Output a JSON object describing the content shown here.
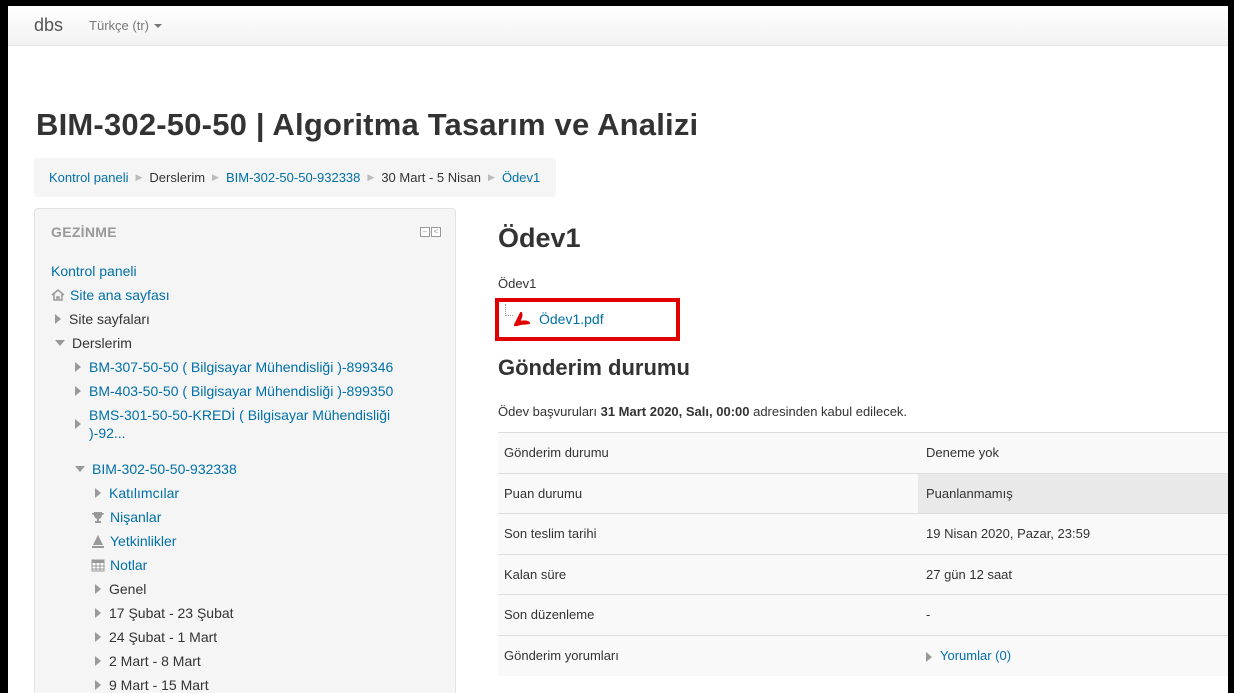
{
  "navbar": {
    "brand": "dbs",
    "language": "Türkçe (tr)"
  },
  "course_title": "BIM-302-50-50 | Algoritma Tasarım ve Analizi",
  "breadcrumb": [
    "Kontrol paneli",
    "Derslerim",
    "BIM-302-50-50-932338",
    "30 Mart - 5 Nisan",
    "Ödev1"
  ],
  "navigation": {
    "title": "GEZİNME",
    "dashboard": "Kontrol paneli",
    "site_home": "Site ana sayfası",
    "site_pages": "Site sayfaları",
    "my_courses": "Derslerim",
    "courses": [
      "BM-307-50-50 ( Bilgisayar Mühendisliği )-899346",
      "BM-403-50-50 ( Bilgisayar Mühendisliği )-899350",
      "BMS-301-50-50-KREDİ ( Bilgisayar Mühendisliği",
      ")-92..."
    ],
    "current_course": "BIM-302-50-50-932338",
    "current_course_items": [
      "Katılımcılar",
      "Nişanlar",
      "Yetkinlikler",
      "Notlar",
      "Genel",
      "17 Şubat - 23 Şubat",
      "24 Şubat - 1 Mart",
      "2 Mart - 8 Mart",
      "9 Mart - 15 Mart"
    ]
  },
  "activity": {
    "title": "Ödev1",
    "intro": "Ödev1",
    "file": "Ödev1.pdf",
    "submission_heading": "Gönderim durumu",
    "allow_note_prefix": "Ödev başvuruları ",
    "allow_note_date": "31 Mart 2020, Salı, 00:00",
    "allow_note_suffix": " adresinden kabul edilecek."
  },
  "status_table": [
    {
      "label": "Gönderim durumu",
      "value": "Deneme yok"
    },
    {
      "label": "Puan durumu",
      "value": "Puanlanmamış"
    },
    {
      "label": "Son teslim tarihi",
      "value": "19 Nisan 2020, Pazar, 23:59"
    },
    {
      "label": "Kalan süre",
      "value": "27 gün 12 saat"
    },
    {
      "label": "Son düzenleme",
      "value": "-"
    },
    {
      "label": "Gönderim yorumları",
      "value": "Yorumlar (0)"
    }
  ],
  "colors": {
    "link": "#0070a8",
    "highlight_border": "#e00000"
  },
  "icons": {
    "site_home": "home-icon",
    "badges": "trophy-icon",
    "competencies": "competency-icon",
    "grades": "table-icon",
    "file": "pdf-icon"
  }
}
